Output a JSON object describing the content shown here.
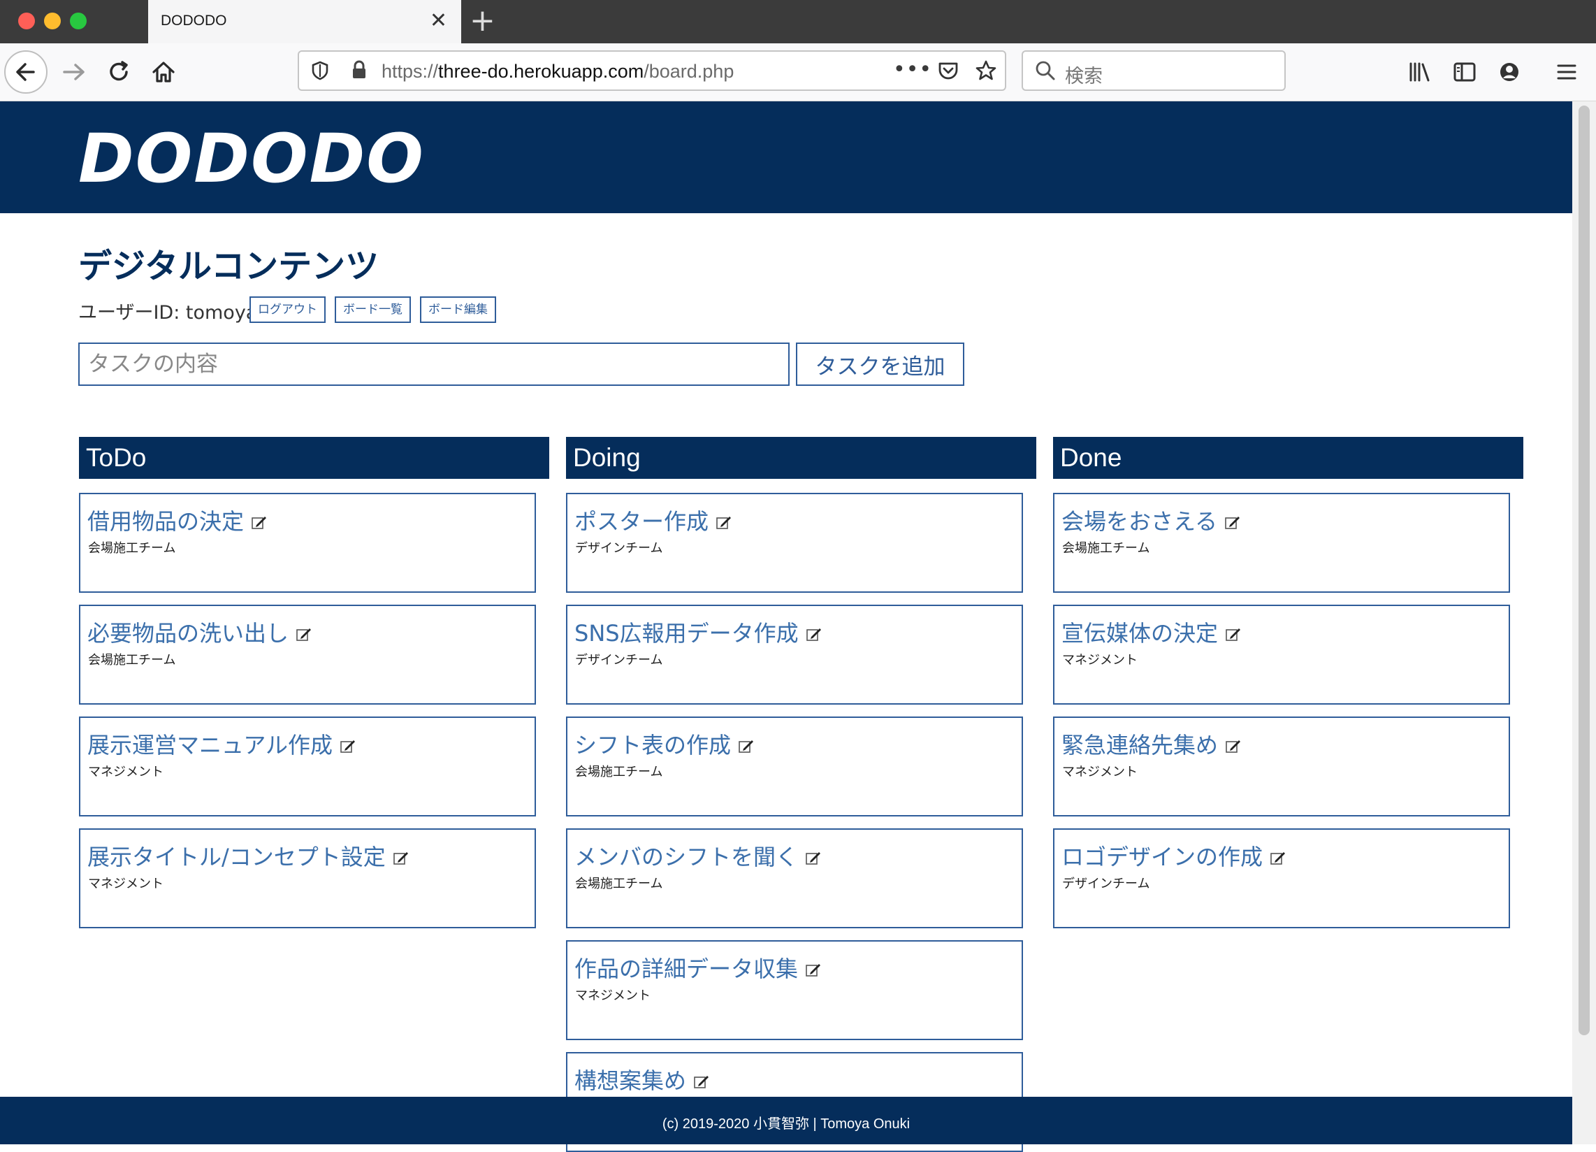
{
  "browser": {
    "tab_title": "DODODO",
    "url_prefix": "https://",
    "url_host": "three-do.herokuapp.com",
    "url_path": "/board.php",
    "search_placeholder": "検索"
  },
  "header": {
    "logo": "DODODO"
  },
  "board": {
    "title": "デジタルコンテンツ",
    "user_line": "ユーザーID: tomoya",
    "logout_label": "ログアウト",
    "board_list_label": "ボード一覧",
    "board_edit_label": "ボード編集",
    "task_placeholder": "タスクの内容",
    "add_task_label": "タスクを追加"
  },
  "columns": [
    {
      "title": "ToDo",
      "cards": [
        {
          "title": "借用物品の決定",
          "team": "会場施工チーム"
        },
        {
          "title": "必要物品の洗い出し",
          "team": "会場施工チーム"
        },
        {
          "title": "展示運営マニュアル作成",
          "team": "マネジメント"
        },
        {
          "title": "展示タイトル/コンセプト設定",
          "team": "マネジメント"
        }
      ]
    },
    {
      "title": "Doing",
      "cards": [
        {
          "title": "ポスター作成",
          "team": "デザインチーム"
        },
        {
          "title": "SNS広報用データ作成",
          "team": "デザインチーム"
        },
        {
          "title": "シフト表の作成",
          "team": "会場施工チーム"
        },
        {
          "title": "メンバのシフトを聞く",
          "team": "会場施工チーム"
        },
        {
          "title": "作品の詳細データ収集",
          "team": "マネジメント"
        },
        {
          "title": "構想案集め",
          "team": ""
        }
      ]
    },
    {
      "title": "Done",
      "cards": [
        {
          "title": "会場をおさえる",
          "team": "会場施工チーム"
        },
        {
          "title": "宣伝媒体の決定",
          "team": "マネジメント"
        },
        {
          "title": "緊急連絡先集め",
          "team": "マネジメント"
        },
        {
          "title": "ロゴデザインの作成",
          "team": "デザインチーム"
        }
      ]
    }
  ],
  "footer": {
    "text": "(c) 2019-2020 小貫智弥 | Tomoya Onuki"
  },
  "colors": {
    "navy": "#052d5b",
    "link_blue": "#3b6fab",
    "border_blue": "#2f5d9a"
  },
  "icons": [
    "back-arrow-icon",
    "forward-arrow-icon",
    "reload-icon",
    "home-icon",
    "shield-icon",
    "lock-icon",
    "more-icon",
    "pocket-icon",
    "star-icon",
    "search-icon",
    "library-icon",
    "sidebar-icon",
    "account-icon",
    "menu-icon",
    "edit-icon"
  ]
}
